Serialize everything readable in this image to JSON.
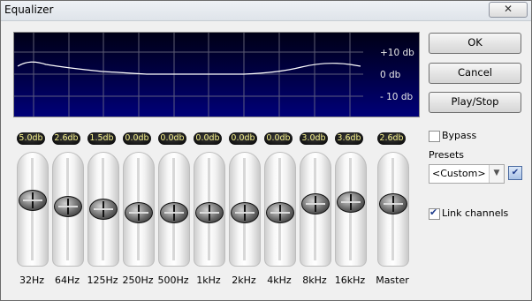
{
  "window": {
    "title": "Equalizer",
    "close_glyph": "✕"
  },
  "graph": {
    "db_labels": {
      "top": "+10 db",
      "mid": "0 db",
      "bottom": "- 10 db"
    }
  },
  "bands": [
    {
      "label": "32Hz",
      "value_label": "5.0db",
      "level": 0.62
    },
    {
      "label": "64Hz",
      "value_label": "2.6db",
      "level": 0.55
    },
    {
      "label": "125Hz",
      "value_label": "1.5db",
      "level": 0.52
    },
    {
      "label": "250Hz",
      "value_label": "0.0db",
      "level": 0.48
    },
    {
      "label": "500Hz",
      "value_label": "0.0db",
      "level": 0.48
    },
    {
      "label": "1kHz",
      "value_label": "0.0db",
      "level": 0.48
    },
    {
      "label": "2kHz",
      "value_label": "0.0db",
      "level": 0.48
    },
    {
      "label": "4kHz",
      "value_label": "0.0db",
      "level": 0.48
    },
    {
      "label": "8kHz",
      "value_label": "3.0db",
      "level": 0.58
    },
    {
      "label": "16kHz",
      "value_label": "3.6db",
      "level": 0.6
    },
    {
      "label": "Master",
      "value_label": "2.6db",
      "level": 0.58
    }
  ],
  "buttons": {
    "ok": "OK",
    "cancel": "Cancel",
    "play_stop": "Play/Stop"
  },
  "bypass": {
    "label": "Bypass",
    "checked": false
  },
  "presets": {
    "label": "Presets",
    "selected": "<Custom>",
    "save_icon": "save-preset-icon"
  },
  "link_channels": {
    "label": "Link channels",
    "checked": true
  },
  "colors": {
    "value_text": "#f7f28c",
    "graph_bg_top": "#000016",
    "graph_bg_bottom": "#000078"
  }
}
